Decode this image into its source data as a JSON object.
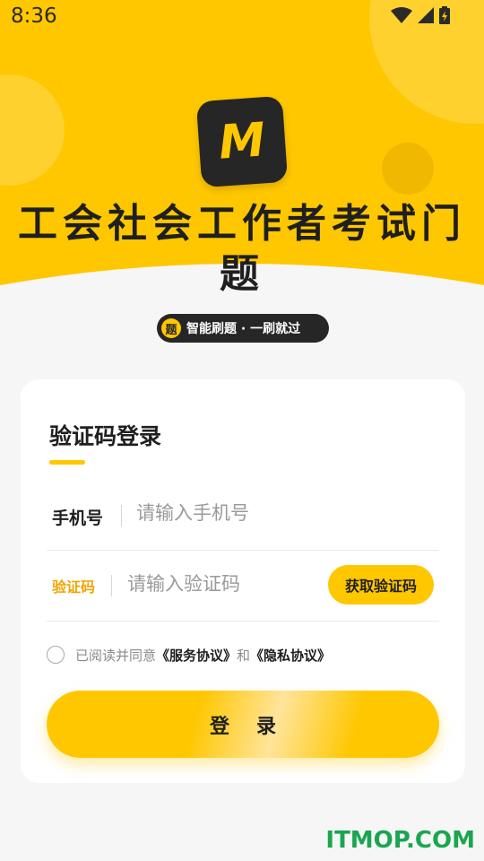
{
  "status_bar": {
    "time": "8:36"
  },
  "logo": {
    "letter": "M"
  },
  "app_title": "工会社会工作者考试门题",
  "slogan": {
    "badge": "题",
    "text": "智能刷题 · 一刷就过"
  },
  "login_card": {
    "title": "验证码登录",
    "phone": {
      "label": "手机号",
      "placeholder": "请输入手机号"
    },
    "code": {
      "label": "验证码",
      "placeholder": "请输入验证码",
      "button": "获取验证码"
    },
    "agreement": {
      "prefix": "已阅读并同意",
      "service_link": "《服务协议》",
      "and": "和",
      "privacy_link": "《隐私协议》"
    },
    "login_button": "登录"
  },
  "watermark": "ITMOP.COM",
  "colors": {
    "accent": "#ffc700",
    "dark": "#262626",
    "watermark": "#1aa64f"
  }
}
